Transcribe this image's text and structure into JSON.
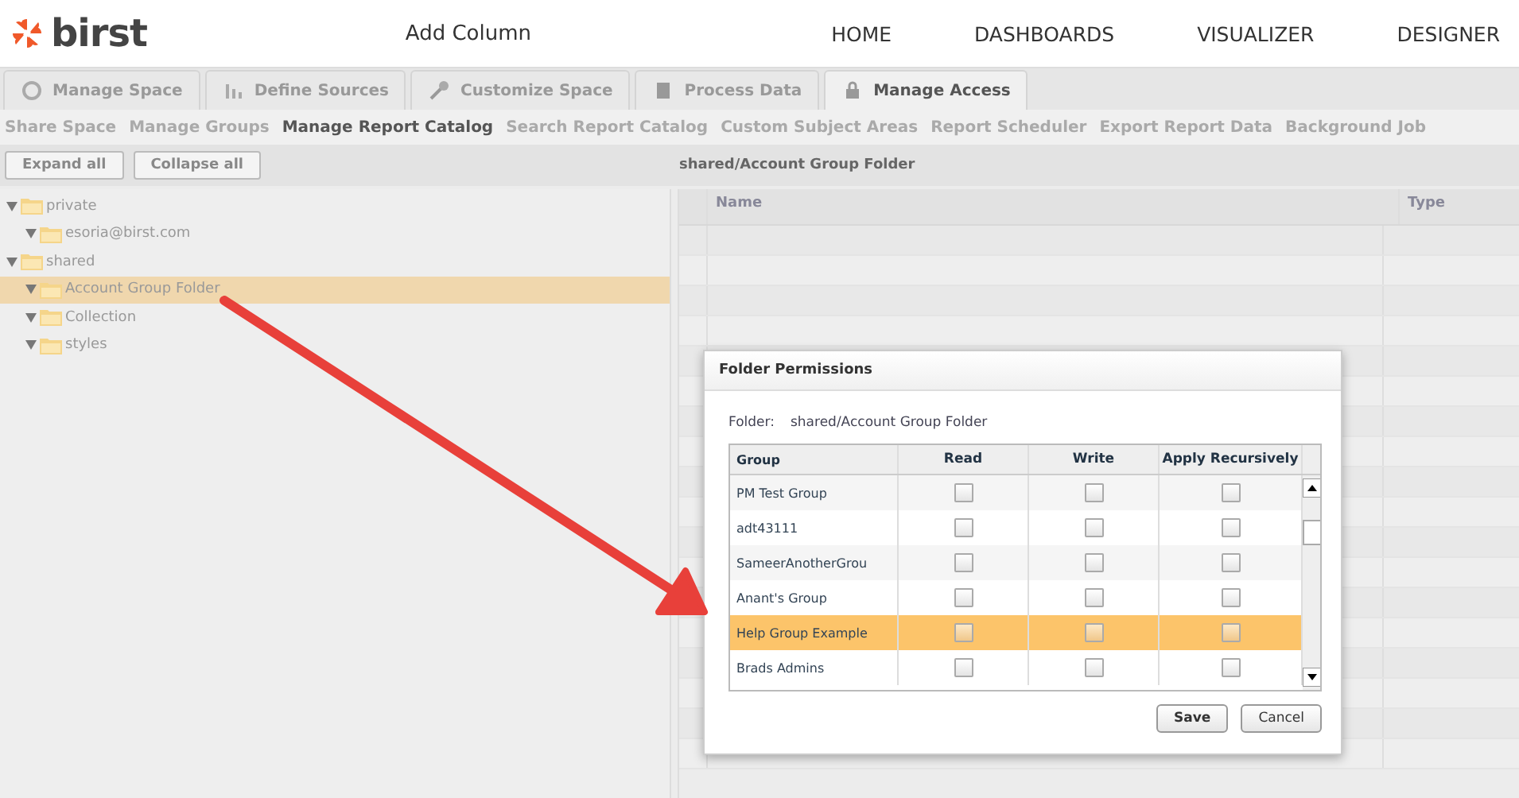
{
  "header": {
    "logo": "birst",
    "title": "Add Column",
    "nav": [
      "HOME",
      "DASHBOARDS",
      "VISUALIZER",
      "DESIGNER"
    ]
  },
  "tabs": [
    {
      "label": "Manage Space",
      "selected": false
    },
    {
      "label": "Define Sources",
      "selected": false
    },
    {
      "label": "Customize Space",
      "selected": false
    },
    {
      "label": "Process Data",
      "selected": false
    },
    {
      "label": "Manage Access",
      "selected": true
    }
  ],
  "subnav": [
    {
      "label": "Share Space",
      "selected": false
    },
    {
      "label": "Manage Groups",
      "selected": false
    },
    {
      "label": "Manage Report Catalog",
      "selected": true
    },
    {
      "label": "Search Report Catalog",
      "selected": false
    },
    {
      "label": "Custom Subject Areas",
      "selected": false
    },
    {
      "label": "Report Scheduler",
      "selected": false
    },
    {
      "label": "Export Report Data",
      "selected": false
    },
    {
      "label": "Background Job",
      "selected": false
    }
  ],
  "toolbar": {
    "buttons": [
      "Expand all",
      "Collapse all"
    ],
    "path": "shared/Account Group Folder"
  },
  "tree": [
    {
      "label": "private",
      "selected": false,
      "children": [
        {
          "label": "esoria@birst.com",
          "selected": false
        }
      ]
    },
    {
      "label": "shared",
      "selected": false,
      "children": [
        {
          "label": "Account Group Folder",
          "selected": true
        },
        {
          "label": "Collection",
          "selected": false
        },
        {
          "label": "styles",
          "selected": false
        }
      ]
    }
  ],
  "grid": {
    "columns": [
      "Name",
      "Type"
    ]
  },
  "dialog": {
    "title": "Folder Permissions",
    "folder_label": "Folder:",
    "folder_value": "shared/Account Group Folder",
    "columns": [
      "Group",
      "Read",
      "Write",
      "Apply Recursively"
    ],
    "rows": [
      {
        "group": "PM Test Group",
        "read": false,
        "write": false,
        "recursive": false,
        "selected": false
      },
      {
        "group": "adt43111",
        "read": false,
        "write": false,
        "recursive": false,
        "selected": false
      },
      {
        "group": "SameerAnotherGrou",
        "read": false,
        "write": false,
        "recursive": false,
        "selected": false
      },
      {
        "group": "Anant's Group",
        "read": false,
        "write": false,
        "recursive": false,
        "selected": false
      },
      {
        "group": "Help Group Example",
        "read": false,
        "write": false,
        "recursive": false,
        "selected": true
      },
      {
        "group": "Brads Admins",
        "read": false,
        "write": false,
        "recursive": false,
        "selected": false
      }
    ],
    "buttons": [
      "Save",
      "Cancel"
    ]
  }
}
